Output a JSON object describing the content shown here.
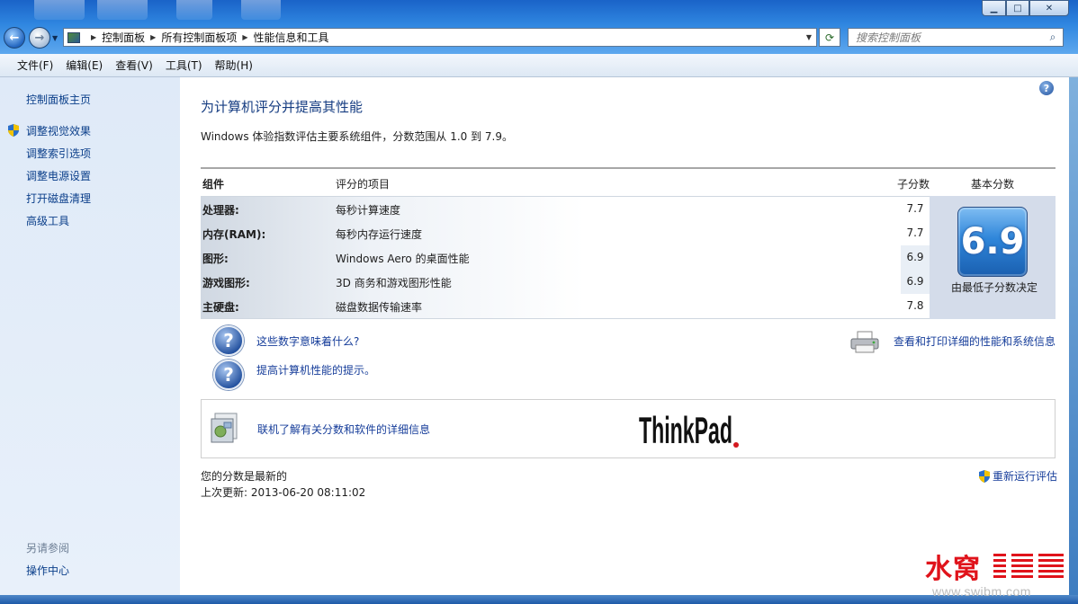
{
  "window": {
    "controls": {
      "min": "▁",
      "max": "□",
      "close": "✕"
    }
  },
  "address": {
    "crumbs": [
      "控制面板",
      "所有控制面板项",
      "性能信息和工具"
    ],
    "search_placeholder": "搜索控制面板"
  },
  "menu": [
    "文件(F)",
    "编辑(E)",
    "查看(V)",
    "工具(T)",
    "帮助(H)"
  ],
  "sidebar": {
    "home": "控制面板主页",
    "links": [
      "调整视觉效果",
      "调整索引选项",
      "调整电源设置",
      "打开磁盘清理",
      "高级工具"
    ],
    "see_also_title": "另请参阅",
    "see_also_links": [
      "操作中心"
    ]
  },
  "main": {
    "title": "为计算机评分并提高其性能",
    "intro": "Windows 体验指数评估主要系统组件，分数范围从 1.0 到 7.9。",
    "table": {
      "headers": {
        "component": "组件",
        "rated": "评分的项目",
        "subscore": "子分数",
        "base": "基本分数"
      },
      "rows": [
        {
          "component": "处理器:",
          "item": "每秒计算速度",
          "score": "7.7"
        },
        {
          "component": "内存(RAM):",
          "item": "每秒内存运行速度",
          "score": "7.7"
        },
        {
          "component": "图形:",
          "item": "Windows Aero 的桌面性能",
          "score": "6.9"
        },
        {
          "component": "游戏图形:",
          "item": "3D 商务和游戏图形性能",
          "score": "6.9"
        },
        {
          "component": "主硬盘:",
          "item": "磁盘数据传输速率",
          "score": "7.8"
        }
      ],
      "base_score": "6.9",
      "base_caption": "由最低子分数决定"
    },
    "links": {
      "what_mean": "这些数字意味着什么?",
      "tips": "提高计算机性能的提示。",
      "print": "查看和打印详细的性能和系统信息",
      "online": "联机了解有关分数和软件的详细信息"
    },
    "brand": "ThinkPad",
    "status": "您的分数是最新的",
    "last_update": "上次更新: 2013-06-20 08:11:02",
    "rerun": "重新运行评估"
  },
  "watermark": {
    "cn": "水窝",
    "url": "www.swibm.com"
  }
}
